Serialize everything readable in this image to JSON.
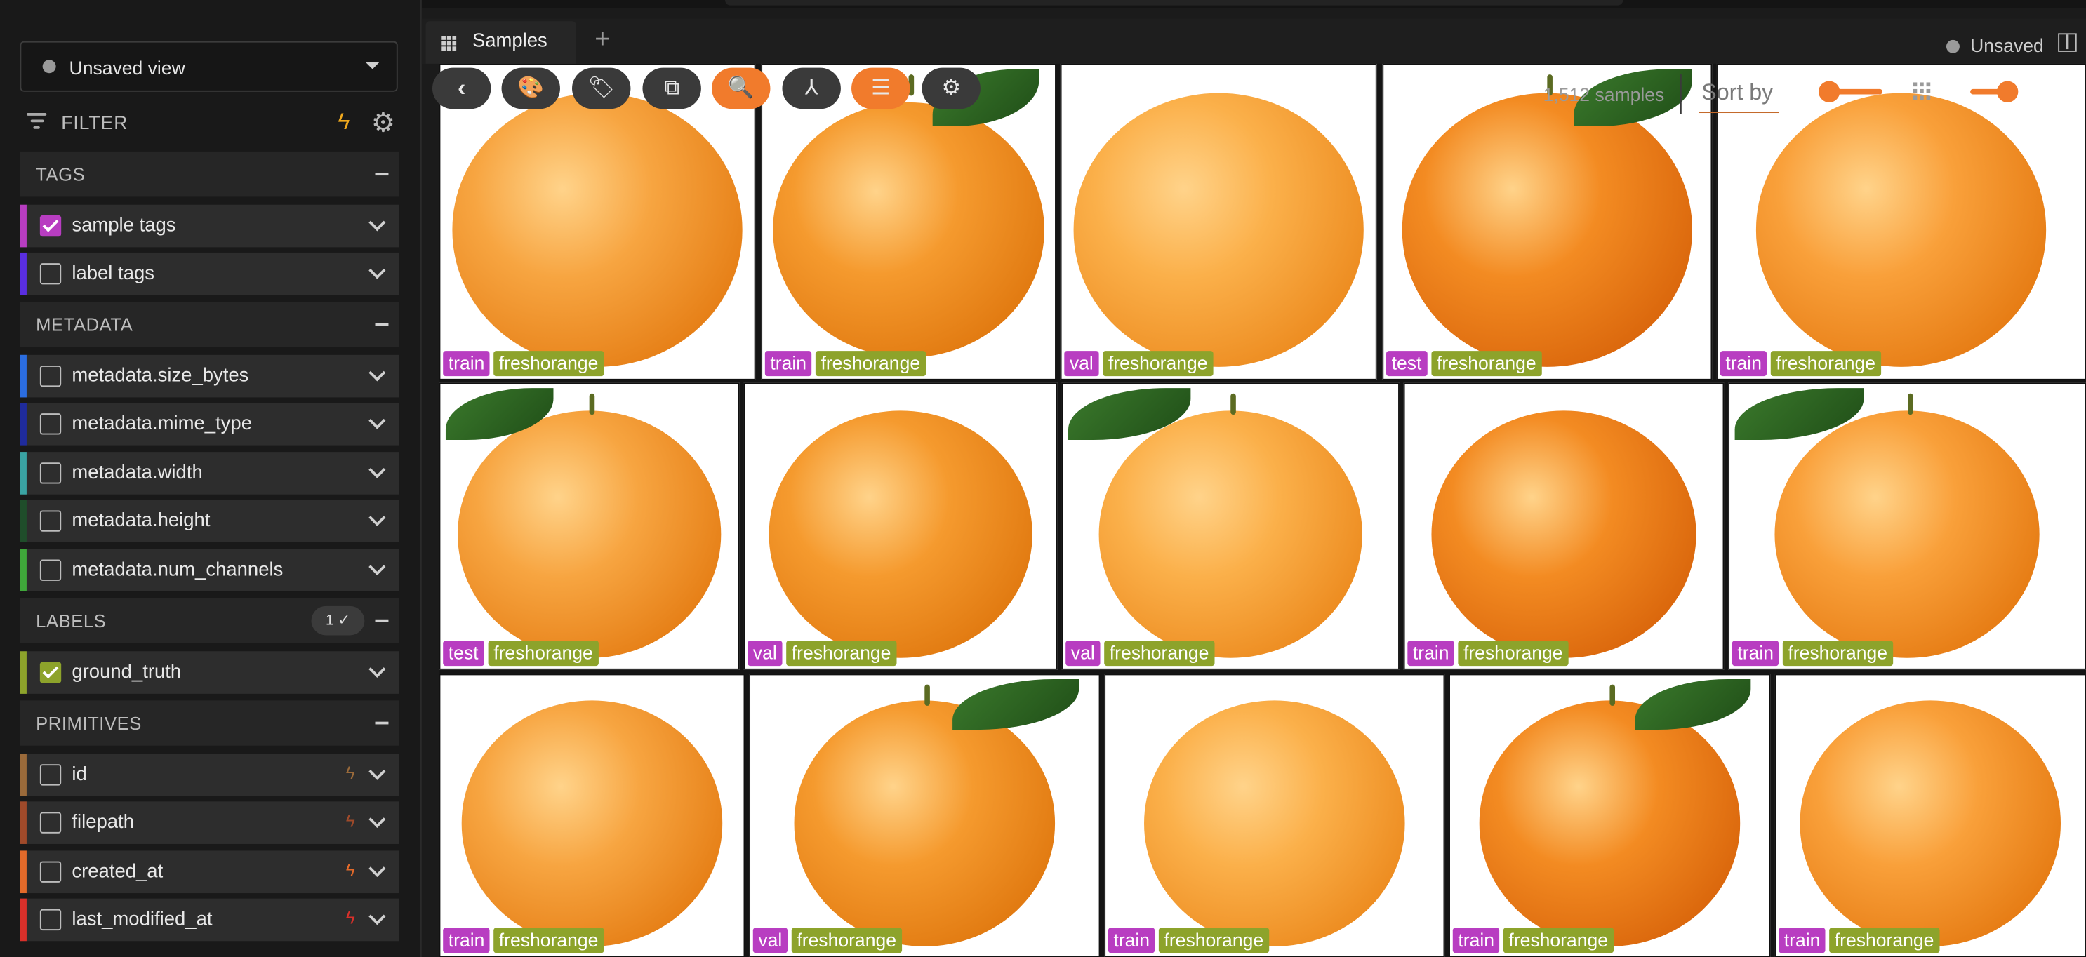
{
  "tab": {
    "label": "Samples",
    "add": "+"
  },
  "status": {
    "unsaved": "Unsaved"
  },
  "sidebar": {
    "view_selector": "Unsaved view",
    "filter_label": "FILTER",
    "sections": {
      "tags": "TAGS",
      "metadata": "METADATA",
      "labels": "LABELS",
      "labels_badge": "1 ✓",
      "primitives": "PRIMITIVES"
    },
    "tag_rows": [
      {
        "label": "sample tags",
        "checked": true,
        "color": "#b83dc1"
      },
      {
        "label": "label tags",
        "checked": false,
        "color": "#5a2ee0"
      }
    ],
    "metadata_rows": [
      {
        "label": "metadata.size_bytes",
        "color": "#2b6de0"
      },
      {
        "label": "metadata.mime_type",
        "color": "#1f2b9c"
      },
      {
        "label": "metadata.width",
        "color": "#3aa3a3"
      },
      {
        "label": "metadata.height",
        "color": "#1f4d2a"
      },
      {
        "label": "metadata.num_channels",
        "color": "#3fa73a"
      }
    ],
    "label_rows": [
      {
        "label": "ground_truth",
        "checked": true,
        "color": "#8da32b"
      }
    ],
    "primitive_rows": [
      {
        "label": "id",
        "color": "#9a6a3a",
        "bolt_color": "#9a6a3a"
      },
      {
        "label": "filepath",
        "color": "#a04a2a",
        "bolt_color": "#a04a2a"
      },
      {
        "label": "created_at",
        "color": "#e36a2a",
        "bolt_color": "#e36a2a"
      },
      {
        "label": "last_modified_at",
        "color": "#d9302a",
        "bolt_color": "#d9302a"
      }
    ]
  },
  "toolbar": {
    "sample_count": "1,512 samples",
    "sort_by": "Sort by"
  },
  "icons": {
    "back": "‹",
    "palette": "🎨",
    "tag": "🏷",
    "crop": "⧉",
    "search": "🔍",
    "merge": "⅄",
    "list": "☰",
    "gear": "⚙",
    "bolt": "ϟ"
  },
  "grid": {
    "class_label": "freshorange",
    "rows": [
      [
        "train",
        "train",
        "val",
        "test",
        "train"
      ],
      [
        "test",
        "val",
        "val",
        "train",
        "train"
      ],
      [
        "train",
        "val",
        "train",
        "train",
        "train"
      ]
    ]
  }
}
